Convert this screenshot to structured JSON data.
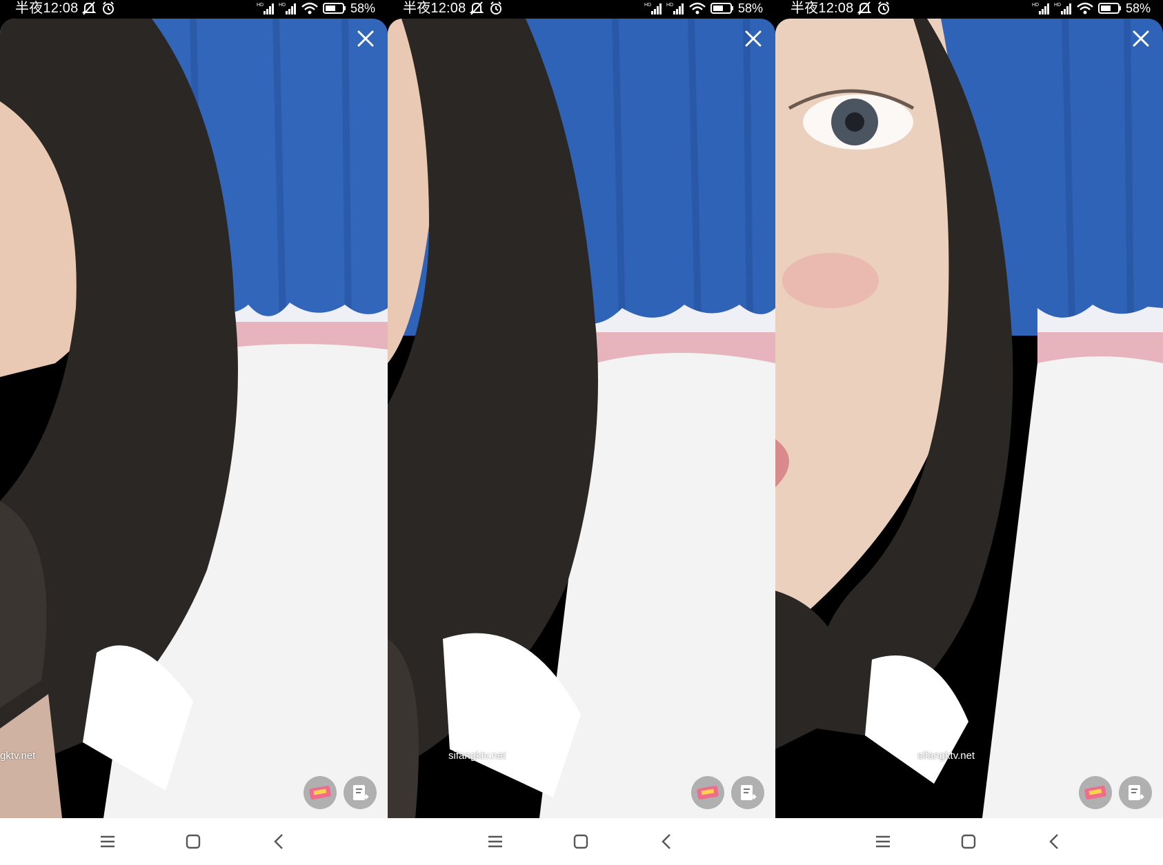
{
  "panels": [
    {
      "status": {
        "time": "半夜12:08",
        "battery": "58%",
        "network": "HD"
      },
      "watermark": "gktv.net",
      "icons": {
        "close": "close-icon",
        "gift": "gift-card-icon",
        "share": "note-share-icon"
      },
      "nav": {
        "menu": "menu-icon",
        "home": "home-square-icon",
        "back": "back-chevron-icon"
      }
    },
    {
      "status": {
        "time": "半夜12:08",
        "battery": "58%",
        "network": "HD"
      },
      "watermark": "sifangktv.net",
      "icons": {
        "close": "close-icon",
        "gift": "gift-card-icon",
        "share": "note-share-icon"
      },
      "nav": {
        "menu": "menu-icon",
        "home": "home-square-icon",
        "back": "back-chevron-icon"
      }
    },
    {
      "status": {
        "time": "半夜12:08",
        "battery": "58%",
        "network": "HD"
      },
      "watermark": "sifangktv.net",
      "icons": {
        "close": "close-icon",
        "gift": "gift-card-icon",
        "share": "note-share-icon"
      },
      "nav": {
        "menu": "menu-icon",
        "home": "home-square-icon",
        "back": "back-chevron-icon"
      }
    }
  ],
  "colors": {
    "curtain": "#2f63b8",
    "pillow": "#e7b3bd",
    "shirt": "#f3f3f3",
    "hair": "#2a2724",
    "skin": "#e9c9b4"
  }
}
